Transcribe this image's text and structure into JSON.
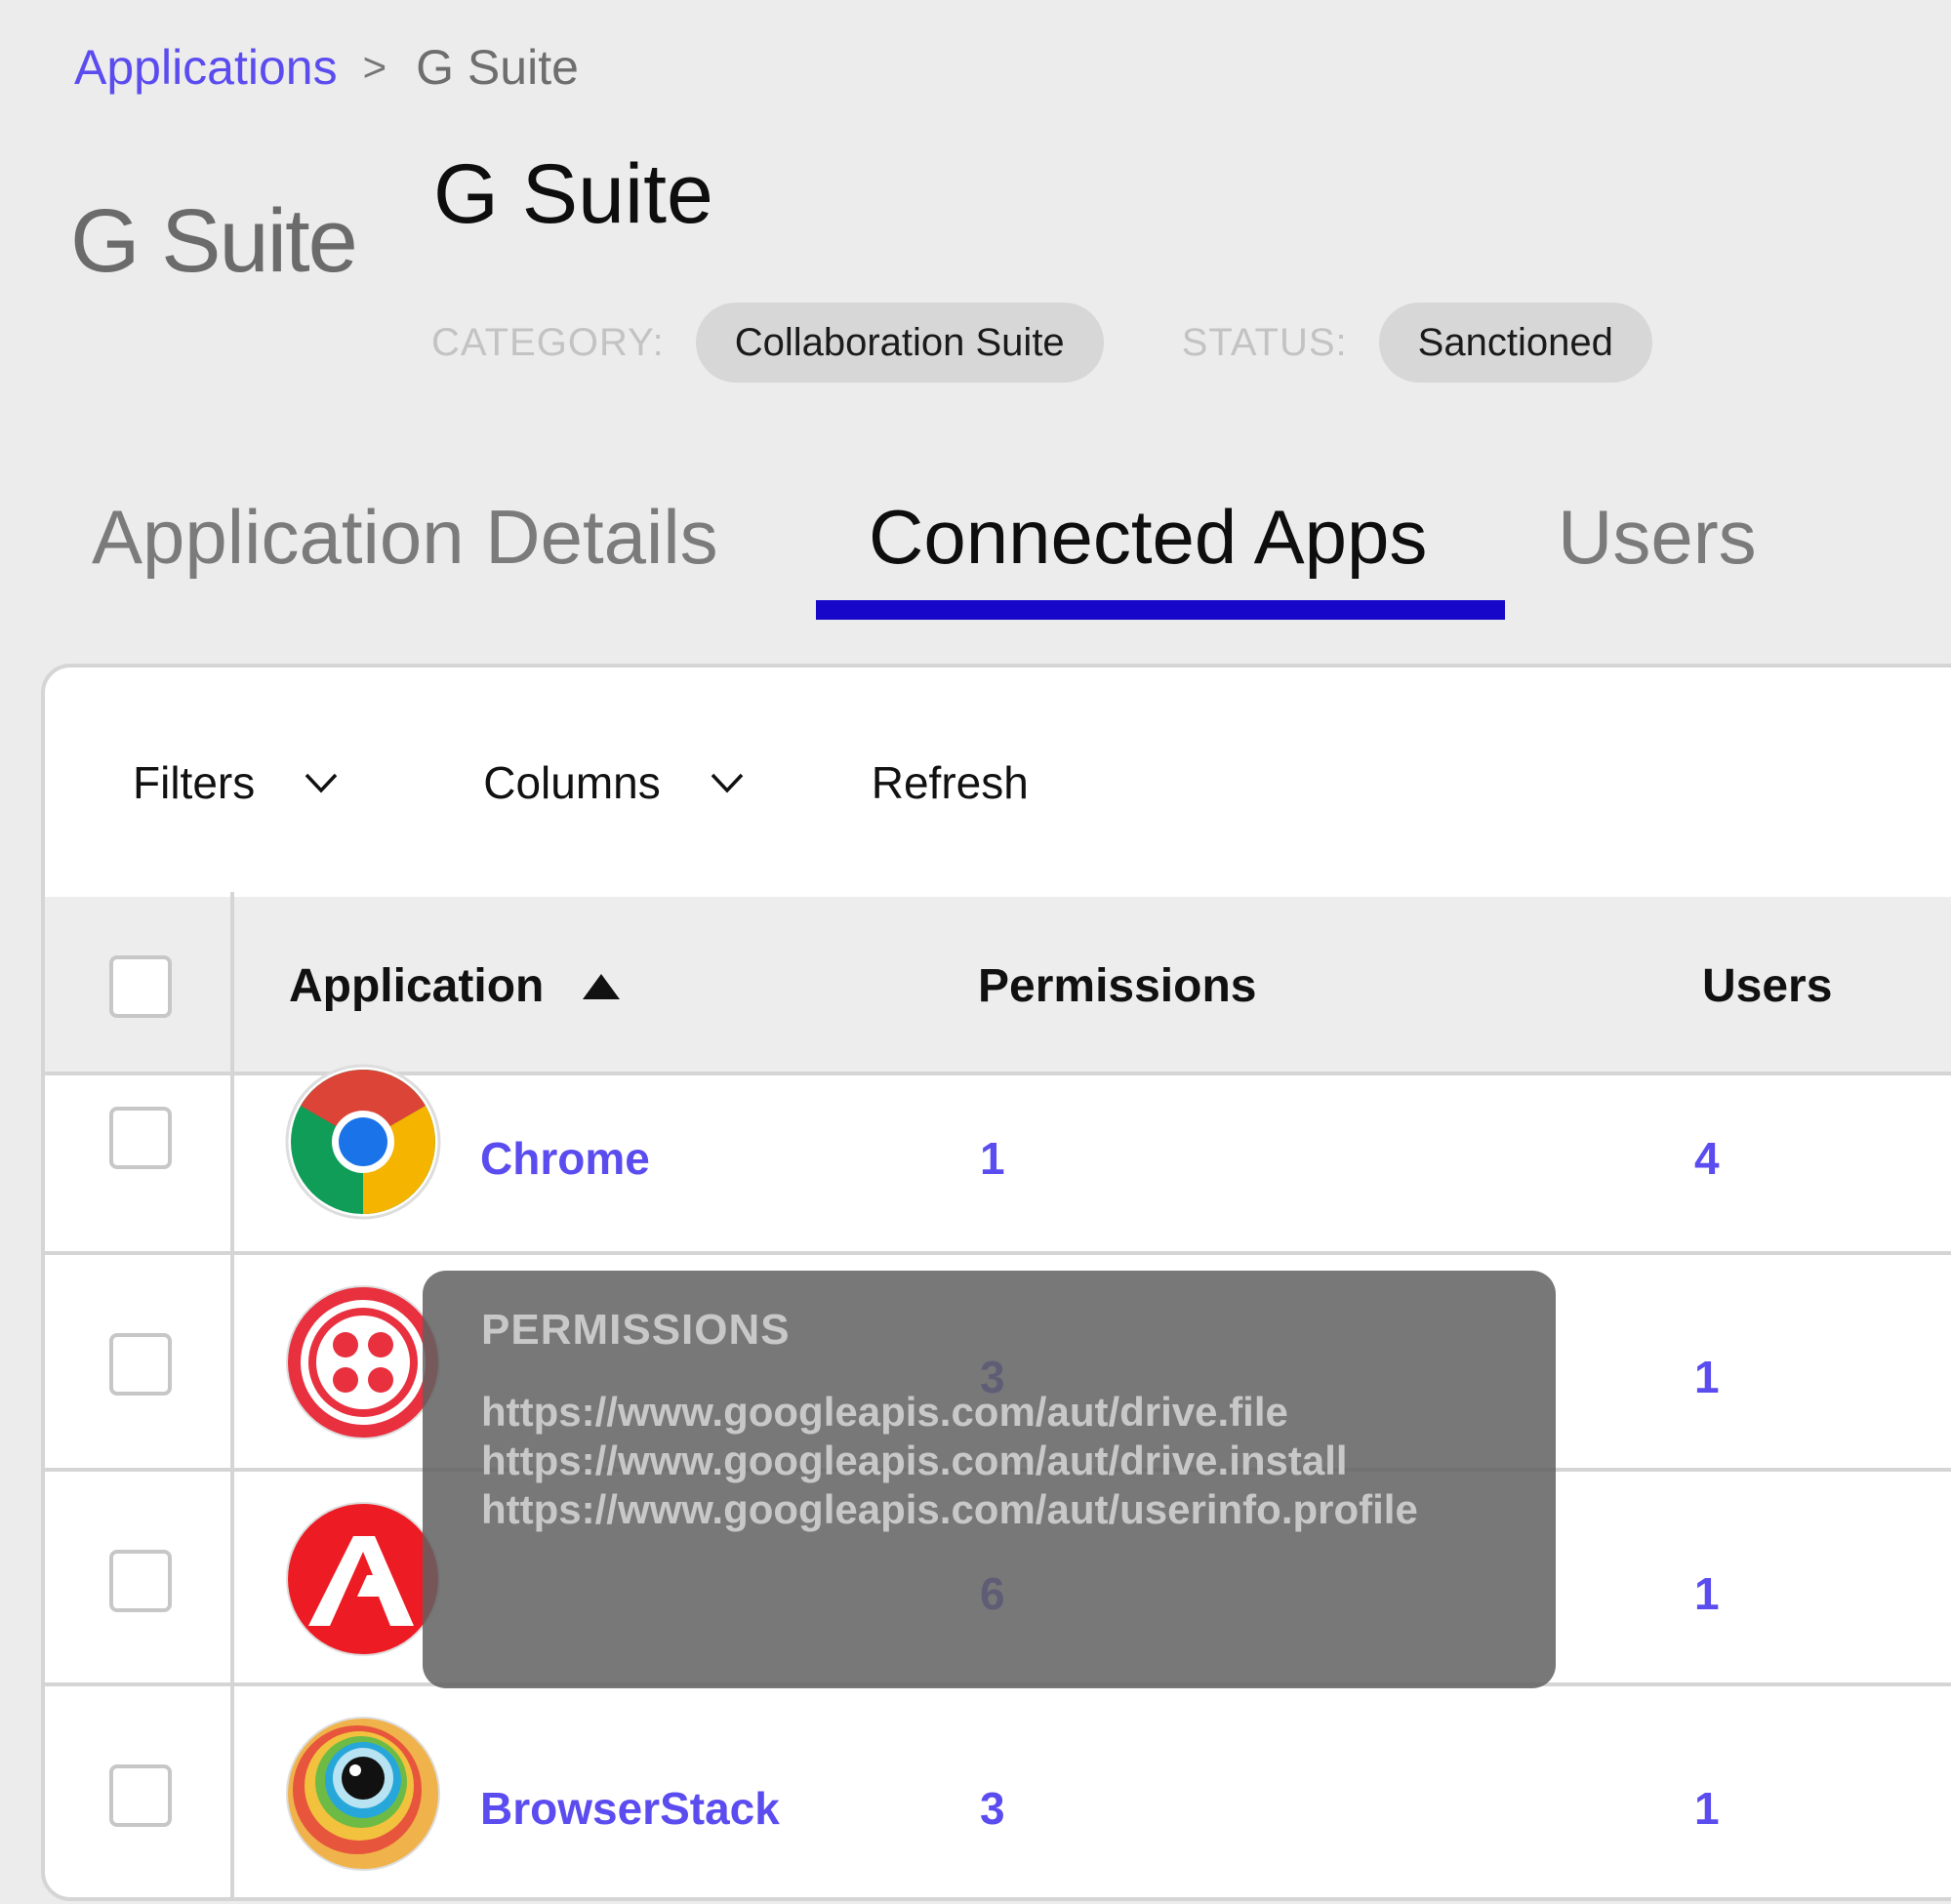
{
  "breadcrumb": {
    "parent": "Applications",
    "separator": ">",
    "current": "G Suite"
  },
  "header": {
    "logo_text": "G Suite",
    "title": "G Suite",
    "category_label": "CATEGORY:",
    "category_value": "Collaboration Suite",
    "status_label": "STATUS:",
    "status_value": "Sanctioned"
  },
  "tabs": [
    {
      "label": "Application Details",
      "active": false
    },
    {
      "label": "Connected Apps",
      "active": true
    },
    {
      "label": "Users",
      "active": false
    }
  ],
  "toolbar": {
    "filters": "Filters",
    "columns": "Columns",
    "refresh": "Refresh"
  },
  "table": {
    "headers": {
      "application": "Application",
      "permissions": "Permissions",
      "users": "Users"
    },
    "rows": [
      {
        "name": "Chrome",
        "permissions": "1",
        "users": "4",
        "icon": "chrome-icon"
      },
      {
        "name": "",
        "permissions": "3",
        "users": "1",
        "icon": "twilio-icon"
      },
      {
        "name": "",
        "permissions": "6",
        "users": "1",
        "icon": "adobe-icon"
      },
      {
        "name": "BrowserStack",
        "permissions": "3",
        "users": "1",
        "icon": "browserstack-icon"
      }
    ]
  },
  "tooltip": {
    "title": "PERMISSIONS",
    "lines": [
      "https://www.googleapis.com/aut/drive.file",
      "https://www.googleapis.com/aut/drive.install",
      "https://www.googleapis.com/aut/userinfo.profile"
    ]
  },
  "colors": {
    "accent": "#5b4cf0",
    "tab_underline": "#1607c9",
    "background": "#ececec"
  }
}
